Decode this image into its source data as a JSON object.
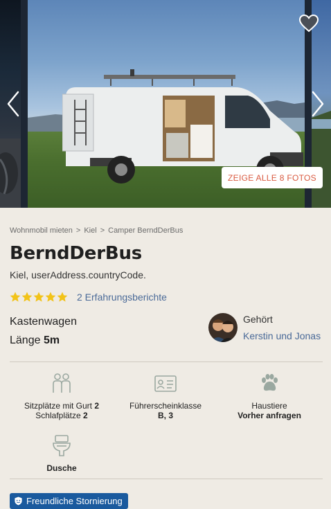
{
  "gallery": {
    "show_all_label": "ZEIGE ALLE 8 FOTOS",
    "favorite_icon": "heart-icon",
    "prev_icon": "chevron-left-icon",
    "next_icon": "chevron-right-icon"
  },
  "breadcrumb": {
    "items": [
      "Wohnmobil mieten",
      "Kiel",
      "Camper BerndDerBus"
    ],
    "separator": ">"
  },
  "listing": {
    "title": "BerndDerBus",
    "address": "Kiel, userAddress.countryCode.",
    "rating_stars": 5,
    "reviews_label": "2 Erfahrungsberichte",
    "vehicle_type": "Kastenwagen",
    "length_label": "Länge",
    "length_value": "5m"
  },
  "owner": {
    "label": "Gehört",
    "name": "Kerstin und Jonas"
  },
  "features": {
    "seats_label": "Sitzplätze mit Gurt",
    "seats_value": "2",
    "sleeps_label": "Schlafplätze",
    "sleeps_value": "2",
    "license_label": "Führerscheinklasse",
    "license_value": "B, 3",
    "pets_label": "Haustiere",
    "pets_value": "Vorher anfragen",
    "shower_label": "Dusche"
  },
  "badge": {
    "label": "Freundliche Stornierung"
  },
  "colors": {
    "background": "#efebe4",
    "link": "#4a6a98",
    "star": "#f2c318",
    "cta_text": "#d9593f",
    "badge_bg": "#1a5a9e"
  }
}
